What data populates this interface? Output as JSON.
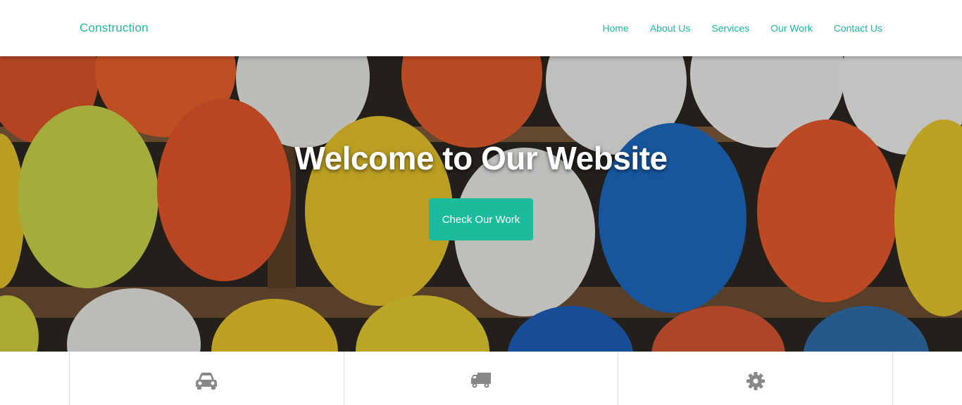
{
  "brand": "Construction",
  "nav": [
    "Home",
    "About Us",
    "Services",
    "Our Work",
    "Contact Us"
  ],
  "hero": {
    "title": "Welcome to Our Website",
    "button_label": "Check Our Work"
  },
  "features": [
    {
      "icon": "car-icon"
    },
    {
      "icon": "truck-icon"
    },
    {
      "icon": "gear-icon"
    }
  ],
  "colors": {
    "accent": "#1abc9c",
    "icon_gray": "#888888",
    "border": "#dddddd"
  }
}
